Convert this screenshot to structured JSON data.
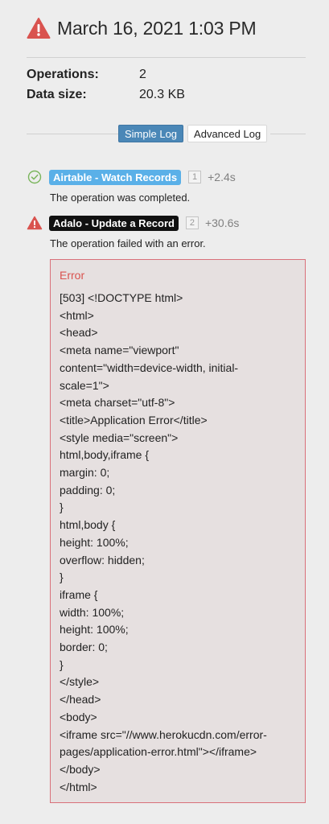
{
  "header": {
    "icon": "warning-triangle-icon",
    "title": "March 16, 2021 1:03 PM"
  },
  "stats": {
    "operations_label": "Operations:",
    "operations_value": "2",
    "datasize_label": "Data size:",
    "datasize_value": "20.3 KB"
  },
  "tabs": {
    "simple": "Simple Log",
    "advanced": "Advanced Log",
    "selected": "Simple Log"
  },
  "operations": [
    {
      "status": "success",
      "status_icon": "check-circle-icon",
      "app": "Airtable - Watch Records",
      "step": "1",
      "time": "+2.4s",
      "message": "The operation was completed."
    },
    {
      "status": "error",
      "status_icon": "warning-triangle-icon",
      "app": "Adalo - Update a Record",
      "step": "2",
      "time": "+30.6s",
      "message": "The operation failed with an error."
    }
  ],
  "error": {
    "title": "Error",
    "lines": [
      "[503] <!DOCTYPE html>",
      "<html>",
      "<head>",
      "<meta name=\"viewport\"",
      "content=\"width=device-width, initial-",
      "scale=1\">",
      "<meta charset=\"utf-8\">",
      "<title>Application Error</title>",
      "<style media=\"screen\">",
      "html,body,iframe {",
      "margin: 0;",
      "padding: 0;",
      "}",
      "html,body {",
      "height: 100%;",
      "overflow: hidden;",
      "}",
      "iframe {",
      "width: 100%;",
      "height: 100%;",
      "border: 0;",
      "}",
      "</style>",
      "</head>",
      "<body>",
      "<iframe src=\"//www.herokucdn.com/error-",
      "pages/application-error.html\"></iframe>",
      "</body>",
      "</html>"
    ]
  },
  "colors": {
    "warning": "#d9534f",
    "success": "#7ab55c",
    "tab_active": "#4a87b7",
    "badge_blue": "#5ab0e8"
  }
}
